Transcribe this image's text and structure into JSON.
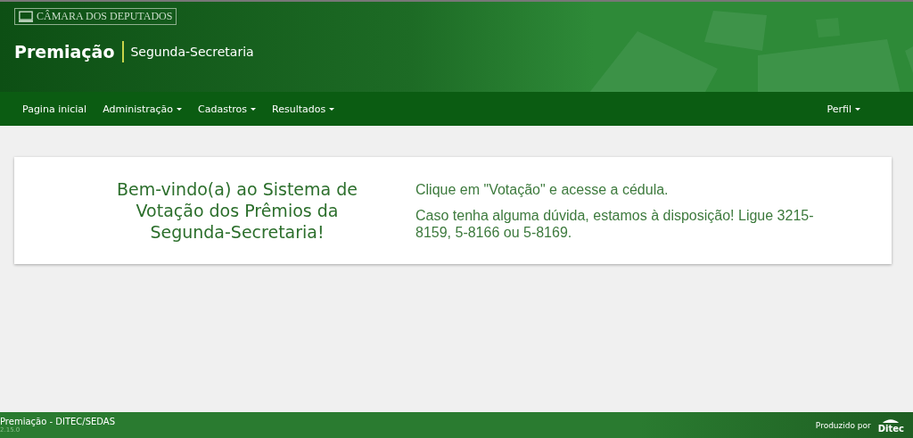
{
  "header": {
    "institution": "CÂMARA DOS DEPUTADOS",
    "title": "Premiação",
    "subtitle": "Segunda-Secretaria"
  },
  "nav": {
    "items": [
      {
        "label": "Pagina inicial",
        "dropdown": false
      },
      {
        "label": "Administração",
        "dropdown": true
      },
      {
        "label": "Cadastros",
        "dropdown": true
      },
      {
        "label": "Resultados",
        "dropdown": true
      }
    ],
    "right": {
      "label": "Perfil",
      "dropdown": true
    }
  },
  "welcome": {
    "heading": "Bem-vindo(a) ao Sistema de Votação dos Prêmios da Segunda-Secretaria!",
    "paragraphs": [
      "Clique em \"Votação\" e acesse a cédula.",
      "Caso tenha alguma dúvida, estamos à disposição! Ligue 3215-8159, 5-8166 ou 5-8169."
    ]
  },
  "footer": {
    "app": "Premiação - DITEC/SEDAS",
    "version": "2.15.0",
    "credit": "Produzido por",
    "logo_text": "Ditec"
  }
}
